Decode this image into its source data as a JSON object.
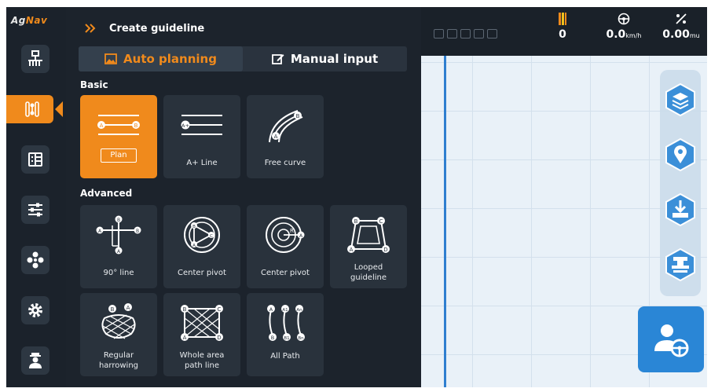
{
  "app": {
    "logo_part1": "Ag",
    "logo_part2": "Nav"
  },
  "panel": {
    "title": "Create guideline",
    "tabs": {
      "auto": "Auto planning",
      "manual": "Manual input"
    },
    "basic_label": "Basic",
    "advanced_label": "Advanced",
    "basic": [
      {
        "label": "Plan",
        "icon": "ab-line-icon"
      },
      {
        "label": "A+ Line",
        "icon": "a-plus-line-icon"
      },
      {
        "label": "Free curve",
        "icon": "free-curve-icon"
      }
    ],
    "advanced": [
      {
        "label": "90° line",
        "icon": "ninety-degree-line-icon"
      },
      {
        "label": "Center pivot",
        "icon": "center-pivot-icon"
      },
      {
        "label": "Center pivot",
        "icon": "center-pivot-radius-icon"
      },
      {
        "label1": "Looped",
        "label2": "guideline",
        "icon": "looped-guideline-icon"
      },
      {
        "label1": "Regular",
        "label2": "harrowing",
        "icon": "regular-harrowing-icon"
      },
      {
        "label1": "Whole area",
        "label2": "path line",
        "icon": "whole-area-path-icon"
      },
      {
        "label": "All Path",
        "icon": "all-path-icon"
      }
    ]
  },
  "status": {
    "count": "0",
    "speed": "0.0",
    "speed_unit": "km/h",
    "area": "0.00",
    "area_unit": "mu"
  },
  "colors": {
    "accent": "#f08a1c",
    "rail": "#1b222b",
    "panel": "#1c232c",
    "card": "#29323c",
    "map_bg": "#e9f1f8",
    "blue": "#2a86d6"
  }
}
